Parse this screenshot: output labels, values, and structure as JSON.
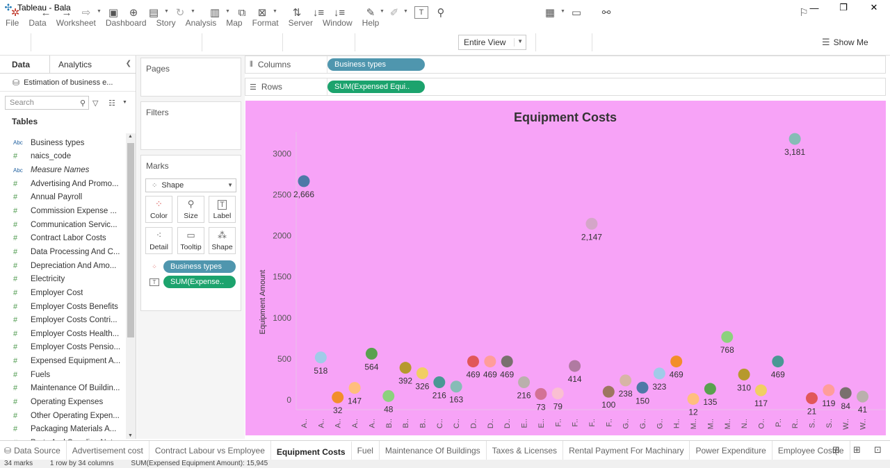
{
  "window": {
    "title": "Tableau - Bala"
  },
  "menu": [
    "File",
    "Data",
    "Worksheet",
    "Dashboard",
    "Story",
    "Analysis",
    "Map",
    "Format",
    "Server",
    "Window",
    "Help"
  ],
  "toolbar": {
    "fit_label": "Entire View",
    "show_me": "Show Me"
  },
  "datapane": {
    "tab_data": "Data",
    "tab_analytics": "Analytics",
    "datasource": "Estimation of business e...",
    "search_placeholder": "Search",
    "tables_heading": "Tables",
    "fields": [
      {
        "type": "Abc",
        "name": "Business types",
        "italic": false
      },
      {
        "type": "#",
        "name": "naics_code",
        "italic": false
      },
      {
        "type": "Abc",
        "name": "Measure Names",
        "italic": true
      },
      {
        "type": "#",
        "name": "Advertising And Promo...",
        "italic": false
      },
      {
        "type": "#",
        "name": "Annual Payroll",
        "italic": false
      },
      {
        "type": "#",
        "name": "Commission Expense ...",
        "italic": false
      },
      {
        "type": "#",
        "name": "Communication Servic...",
        "italic": false
      },
      {
        "type": "#",
        "name": "Contract Labor Costs",
        "italic": false
      },
      {
        "type": "#",
        "name": "Data Processing And C...",
        "italic": false
      },
      {
        "type": "#",
        "name": "Depreciation And Amo...",
        "italic": false
      },
      {
        "type": "#",
        "name": "Electricity",
        "italic": false
      },
      {
        "type": "#",
        "name": "Employer Cost",
        "italic": false
      },
      {
        "type": "#",
        "name": "Employer Costs Benefits",
        "italic": false
      },
      {
        "type": "#",
        "name": "Employer Costs Contri...",
        "italic": false
      },
      {
        "type": "#",
        "name": "Employer Costs Health...",
        "italic": false
      },
      {
        "type": "#",
        "name": "Employer Costs Pensio...",
        "italic": false
      },
      {
        "type": "#",
        "name": "Expensed Equipment A...",
        "italic": false
      },
      {
        "type": "#",
        "name": "Fuels",
        "italic": false
      },
      {
        "type": "#",
        "name": "Maintenance Of Buildin...",
        "italic": false
      },
      {
        "type": "#",
        "name": "Operating Expenses",
        "italic": false
      },
      {
        "type": "#",
        "name": "Other Operating Expen...",
        "italic": false
      },
      {
        "type": "#",
        "name": "Packaging Materials A...",
        "italic": false
      },
      {
        "type": "#",
        "name": "Parts And Supplies Not...",
        "italic": false
      }
    ]
  },
  "cards": {
    "pages": "Pages",
    "filters": "Filters",
    "marks": "Marks",
    "mark_type": "Shape",
    "buttons": [
      "Color",
      "Size",
      "Label",
      "Detail",
      "Tooltip",
      "Shape"
    ],
    "pills": [
      {
        "kind": "color",
        "label": "Business types"
      },
      {
        "kind": "label",
        "label": "SUM(Expense.."
      }
    ]
  },
  "shelves": {
    "columns_label": "Columns",
    "columns_pill": "Business types",
    "rows_label": "Rows",
    "rows_pill": "SUM(Expensed Equi.."
  },
  "chart_data": {
    "type": "scatter",
    "title": "Equipment Costs",
    "ylabel": "Equipment Amount",
    "xlabel": "",
    "ylim": [
      0,
      3300
    ],
    "yticks": [
      0,
      500,
      1000,
      1500,
      2000,
      2500,
      3000
    ],
    "grid": false,
    "categories": [
      "A..",
      "A..",
      "A..",
      "A..",
      "A..",
      "B..",
      "B..",
      "B..",
      "C..",
      "C..",
      "D..",
      "D..",
      "D..",
      "E..",
      "E..",
      "F..",
      "F..",
      "F..",
      "F..",
      "G..",
      "G..",
      "G..",
      "H..",
      "M..",
      "M..",
      "M..",
      "N..",
      "O..",
      "P..",
      "R..",
      "S..",
      "S..",
      "W..",
      "W.."
    ],
    "values": [
      2666,
      518,
      32,
      147,
      564,
      48,
      392,
      326,
      216,
      163,
      469,
      469,
      469,
      216,
      73,
      79,
      414,
      2147,
      100,
      238,
      150,
      323,
      469,
      12,
      135,
      768,
      310,
      117,
      469,
      3181,
      21,
      119,
      84,
      41
    ],
    "labels": [
      "2,666",
      "518",
      "32",
      "147",
      "564",
      "48",
      "392",
      "326",
      "216",
      "163",
      "469",
      "469",
      "469",
      "216",
      "73",
      "79",
      "414",
      "2,147",
      "100",
      "238",
      "150",
      "323",
      "469",
      "12",
      "135",
      "768",
      "310",
      "117",
      "469",
      "3,181",
      "21",
      "119",
      "84",
      "41"
    ],
    "colors": [
      "#4e79a7",
      "#a0cbe8",
      "#f28e2b",
      "#ffbe7d",
      "#59a14f",
      "#8cd17d",
      "#b6992d",
      "#f1ce63",
      "#499894",
      "#86bcb6",
      "#e15759",
      "#ff9d9a",
      "#79706e",
      "#bab0ac",
      "#d37295",
      "#fabfd2",
      "#b07aa1",
      "#d4a6c8",
      "#9d7660",
      "#d7b5a6",
      "#4e79a7",
      "#a0cbe8",
      "#f28e2b",
      "#ffbe7d",
      "#59a14f",
      "#8cd17d",
      "#b6992d",
      "#f1ce63",
      "#499894",
      "#86bcb6",
      "#e15759",
      "#ff9d9a",
      "#79706e",
      "#bab0ac"
    ],
    "background": "#f7a3f7"
  },
  "sheets": {
    "data_source": "Data Source",
    "tabs": [
      "Advertisement cost",
      "Contract Labour vs Employee",
      "Equipment Costs",
      "Fuel",
      "Maintenance Of Buildings",
      "Taxes & Licenses",
      "Rental Payment For Machinary",
      "Power Expenditure",
      "Employee Cost(le"
    ],
    "active": "Equipment Costs"
  },
  "status": {
    "marks": "34 marks",
    "layout": "1 row by 34 columns",
    "sum": "SUM(Expensed Equipment Amount): 15,945"
  }
}
